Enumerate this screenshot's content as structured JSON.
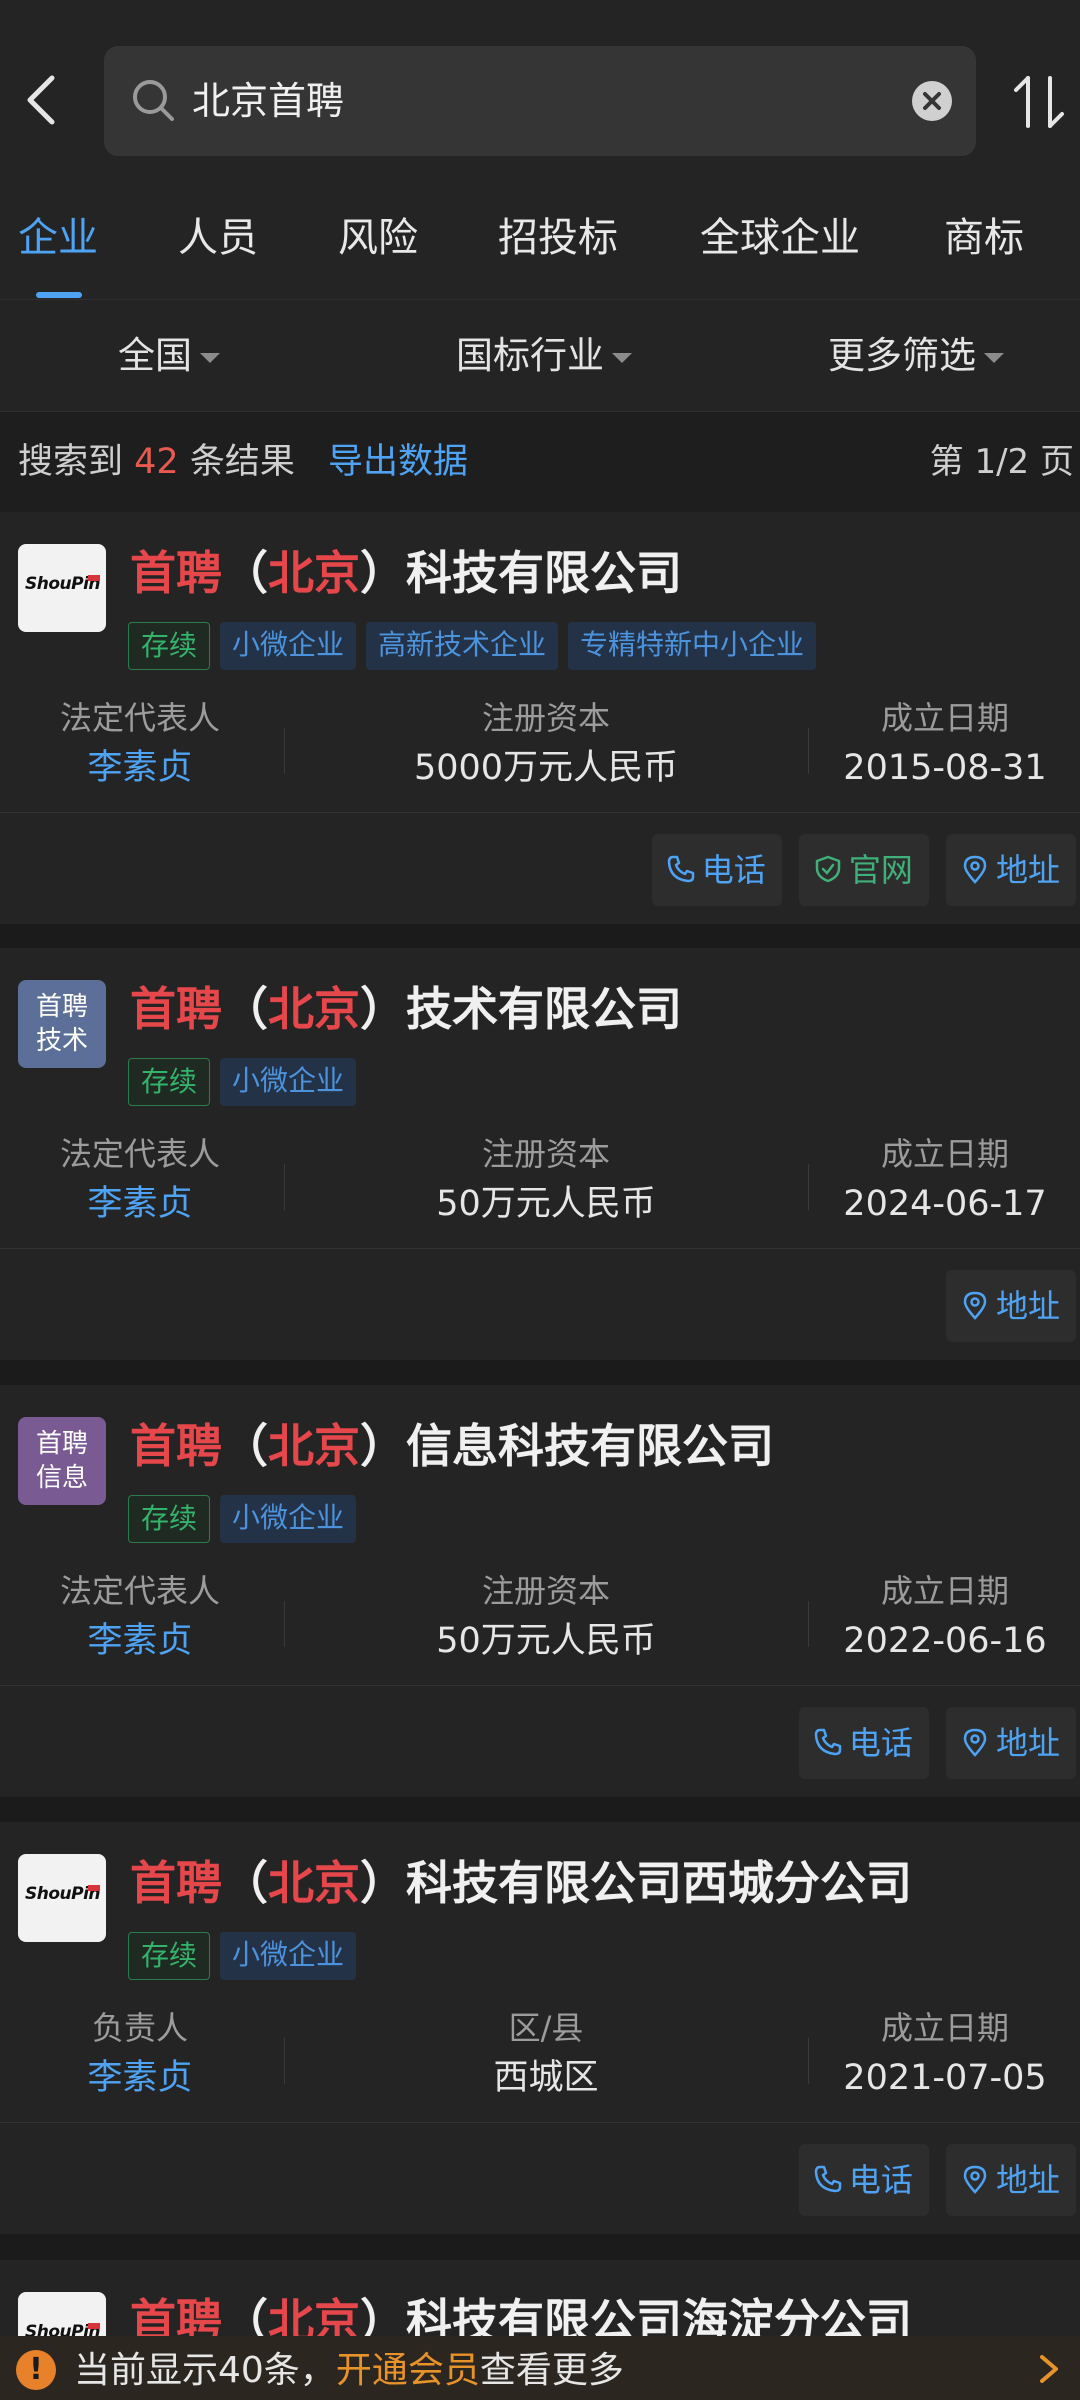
{
  "search": {
    "query": "北京首聘"
  },
  "tabs": [
    {
      "label": "企业",
      "active": true
    },
    {
      "label": "人员"
    },
    {
      "label": "风险"
    },
    {
      "label": "招投标"
    },
    {
      "label": "全球企业"
    },
    {
      "label": "商标"
    }
  ],
  "filters": {
    "region": "全国",
    "industry": "国标行业",
    "more": "更多筛选"
  },
  "results": {
    "prefix": "搜索到",
    "count": "42",
    "suffix": "条结果",
    "export_label": "导出数据",
    "page_indicator": "第 1/2 页"
  },
  "companies": [
    {
      "logo_type": "brand",
      "logo_text": "ShouPin",
      "name_part1": "首聘",
      "name_open": "（",
      "name_hl": "北京",
      "name_close": "）",
      "name_rest": "科技有限公司",
      "tags": [
        "存续",
        "小微企业",
        "高新技术企业",
        "专精特新中小企业"
      ],
      "col1_label": "法定代表人",
      "col1_value": "李素贞",
      "col2_label": "注册资本",
      "col2_value": "5000万元人民币",
      "col3_label": "成立日期",
      "col3_value": "2015-08-31",
      "actions": [
        "电话",
        "官网",
        "地址"
      ]
    },
    {
      "logo_type": "text",
      "logo_line1": "首聘",
      "logo_line2": "技术",
      "logo_color": "#5b6f98",
      "name_part1": "首聘",
      "name_open": "（",
      "name_hl": "北京",
      "name_close": "）",
      "name_rest": "技术有限公司",
      "tags": [
        "存续",
        "小微企业"
      ],
      "col1_label": "法定代表人",
      "col1_value": "李素贞",
      "col2_label": "注册资本",
      "col2_value": "50万元人民币",
      "col3_label": "成立日期",
      "col3_value": "2024-06-17",
      "actions": [
        "地址"
      ]
    },
    {
      "logo_type": "text",
      "logo_line1": "首聘",
      "logo_line2": "信息",
      "logo_color": "#7a5a93",
      "name_part1": "首聘",
      "name_open": "（",
      "name_hl": "北京",
      "name_close": "）",
      "name_rest": "信息科技有限公司",
      "tags": [
        "存续",
        "小微企业"
      ],
      "col1_label": "法定代表人",
      "col1_value": "李素贞",
      "col2_label": "注册资本",
      "col2_value": "50万元人民币",
      "col3_label": "成立日期",
      "col3_value": "2022-06-16",
      "actions": [
        "电话",
        "地址"
      ]
    },
    {
      "logo_type": "brand",
      "logo_text": "ShouPin",
      "name_part1": "首聘",
      "name_open": "（",
      "name_hl": "北京",
      "name_close": "）",
      "name_rest": "科技有限公司西城分公司",
      "tags": [
        "存续",
        "小微企业"
      ],
      "col1_label": "负责人",
      "col1_value": "李素贞",
      "col2_label": "区/县",
      "col2_value": "西城区",
      "col3_label": "成立日期",
      "col3_value": "2021-07-05",
      "actions": [
        "电话",
        "地址"
      ]
    },
    {
      "logo_type": "brand",
      "logo_text": "ShouPin",
      "name_part1": "首聘",
      "name_open": "（",
      "name_hl": "北京",
      "name_close": "）",
      "name_rest": "科技有限公司海淀分公司"
    }
  ],
  "banner": {
    "icon": "warning-icon",
    "text_prefix": "当前显示40条，",
    "vip_label": "开通会员",
    "text_suffix": "查看更多"
  },
  "colors": {
    "accent": "#4ea3f5",
    "highlight": "#e5474b",
    "status_green": "#34b36b",
    "vip_orange": "#e8922a"
  }
}
